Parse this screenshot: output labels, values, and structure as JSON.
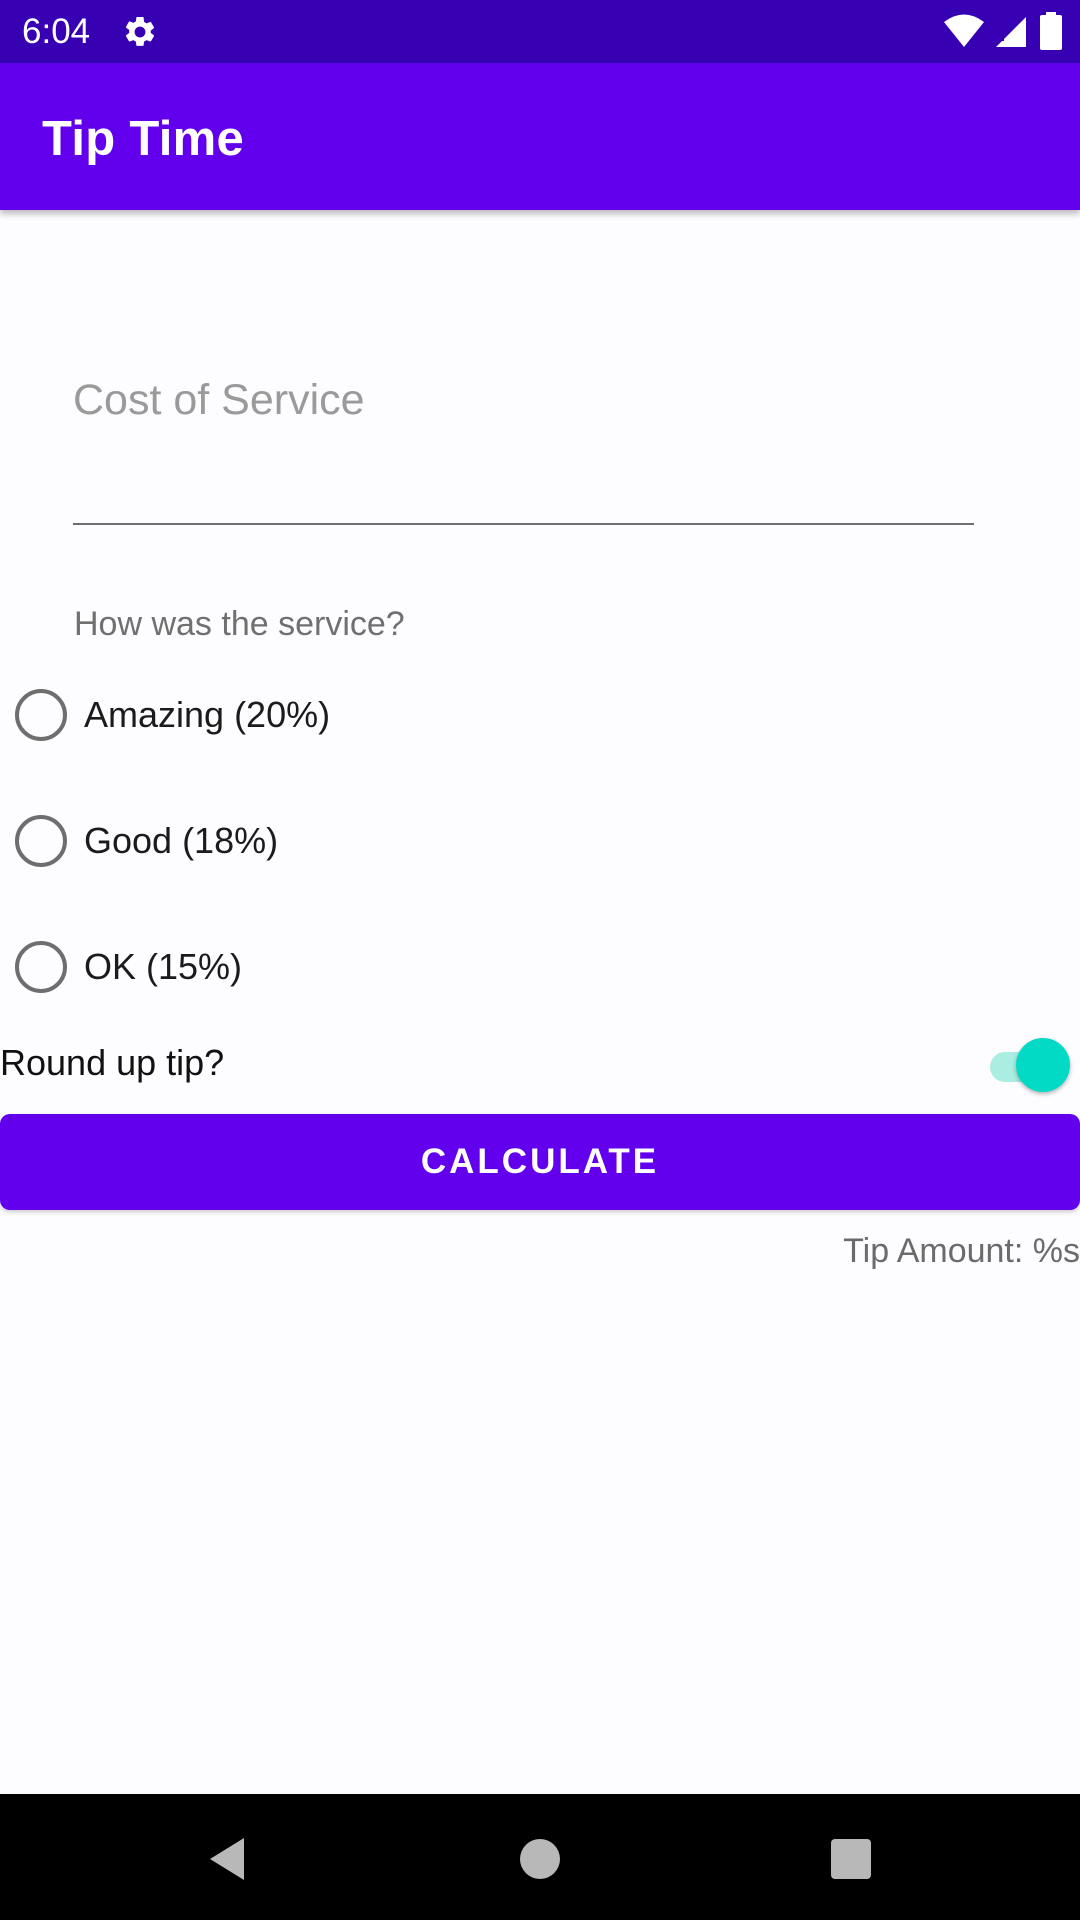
{
  "status_bar": {
    "time": "6:04",
    "icons": [
      "settings-gear-icon",
      "wifi-icon",
      "signal-icon",
      "battery-icon"
    ],
    "background": "#3700b3"
  },
  "app_bar": {
    "title": "Tip Time",
    "background": "#6200ee"
  },
  "form": {
    "cost_placeholder": "Cost of Service",
    "cost_value": "",
    "question": "How was the service?",
    "options": [
      {
        "label": "Amazing (20%)",
        "selected": false
      },
      {
        "label": "Good (18%)",
        "selected": false
      },
      {
        "label": "OK (15%)",
        "selected": false
      }
    ],
    "round_up_label": "Round up tip?",
    "round_up_on": true,
    "switch_color": "#03dac5",
    "calculate_label": "CALCULATE",
    "tip_amount": "Tip Amount: %s"
  },
  "nav_bar": {
    "icons": [
      "back-icon",
      "home-icon",
      "recents-icon"
    ]
  }
}
